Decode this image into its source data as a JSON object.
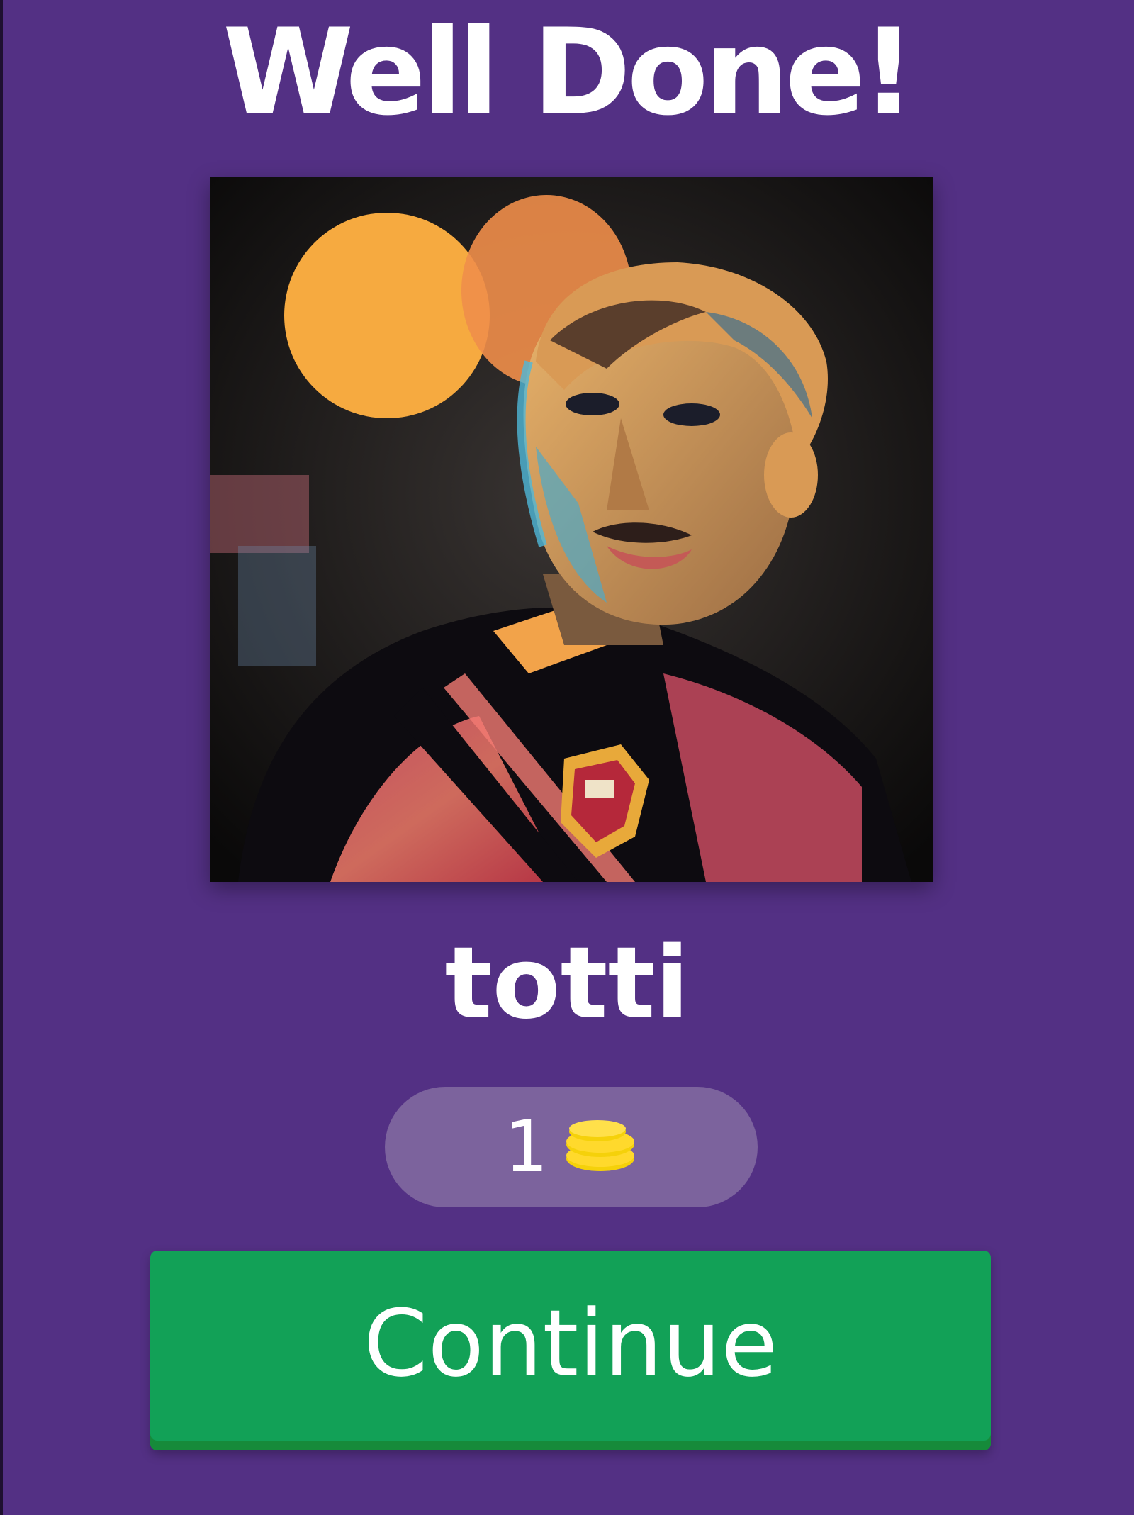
{
  "screen": {
    "title": "Well Done!",
    "answer": "totti"
  },
  "reward": {
    "amount": "1",
    "icon": "coins-icon"
  },
  "continue_button": {
    "label": "Continue"
  },
  "colors": {
    "background": "#533084",
    "pill": "#7c639d",
    "button": "#12a157",
    "coin": "#f5d10a"
  }
}
